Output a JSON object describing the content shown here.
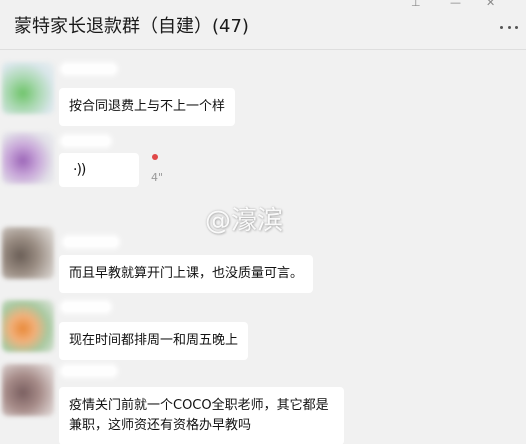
{
  "header": {
    "title": "蒙特家长退款群（自建）(47)",
    "pin_icon": "pin-icon",
    "minimize_icon": "minimize-icon",
    "close_icon": "close-icon",
    "more_icon": "more-icon"
  },
  "messages": [
    {
      "type": "text",
      "text": "按合同退费上与不上一个样"
    },
    {
      "type": "voice",
      "voice_glyph": "·))",
      "duration": "4\""
    },
    {
      "type": "text",
      "text": "而且早教就算开门上课，也没质量可言。"
    },
    {
      "type": "text",
      "text": "现在时间都排周一和周五晚上"
    },
    {
      "type": "text",
      "text": "疫情关门前就一个COCO全职老师，其它都是兼职，这师资还有资格办早教吗"
    }
  ],
  "watermark": "@濠滨",
  "colors": {
    "background": "#f1f1f1",
    "bubble": "#ffffff",
    "unread": "#e04848"
  }
}
